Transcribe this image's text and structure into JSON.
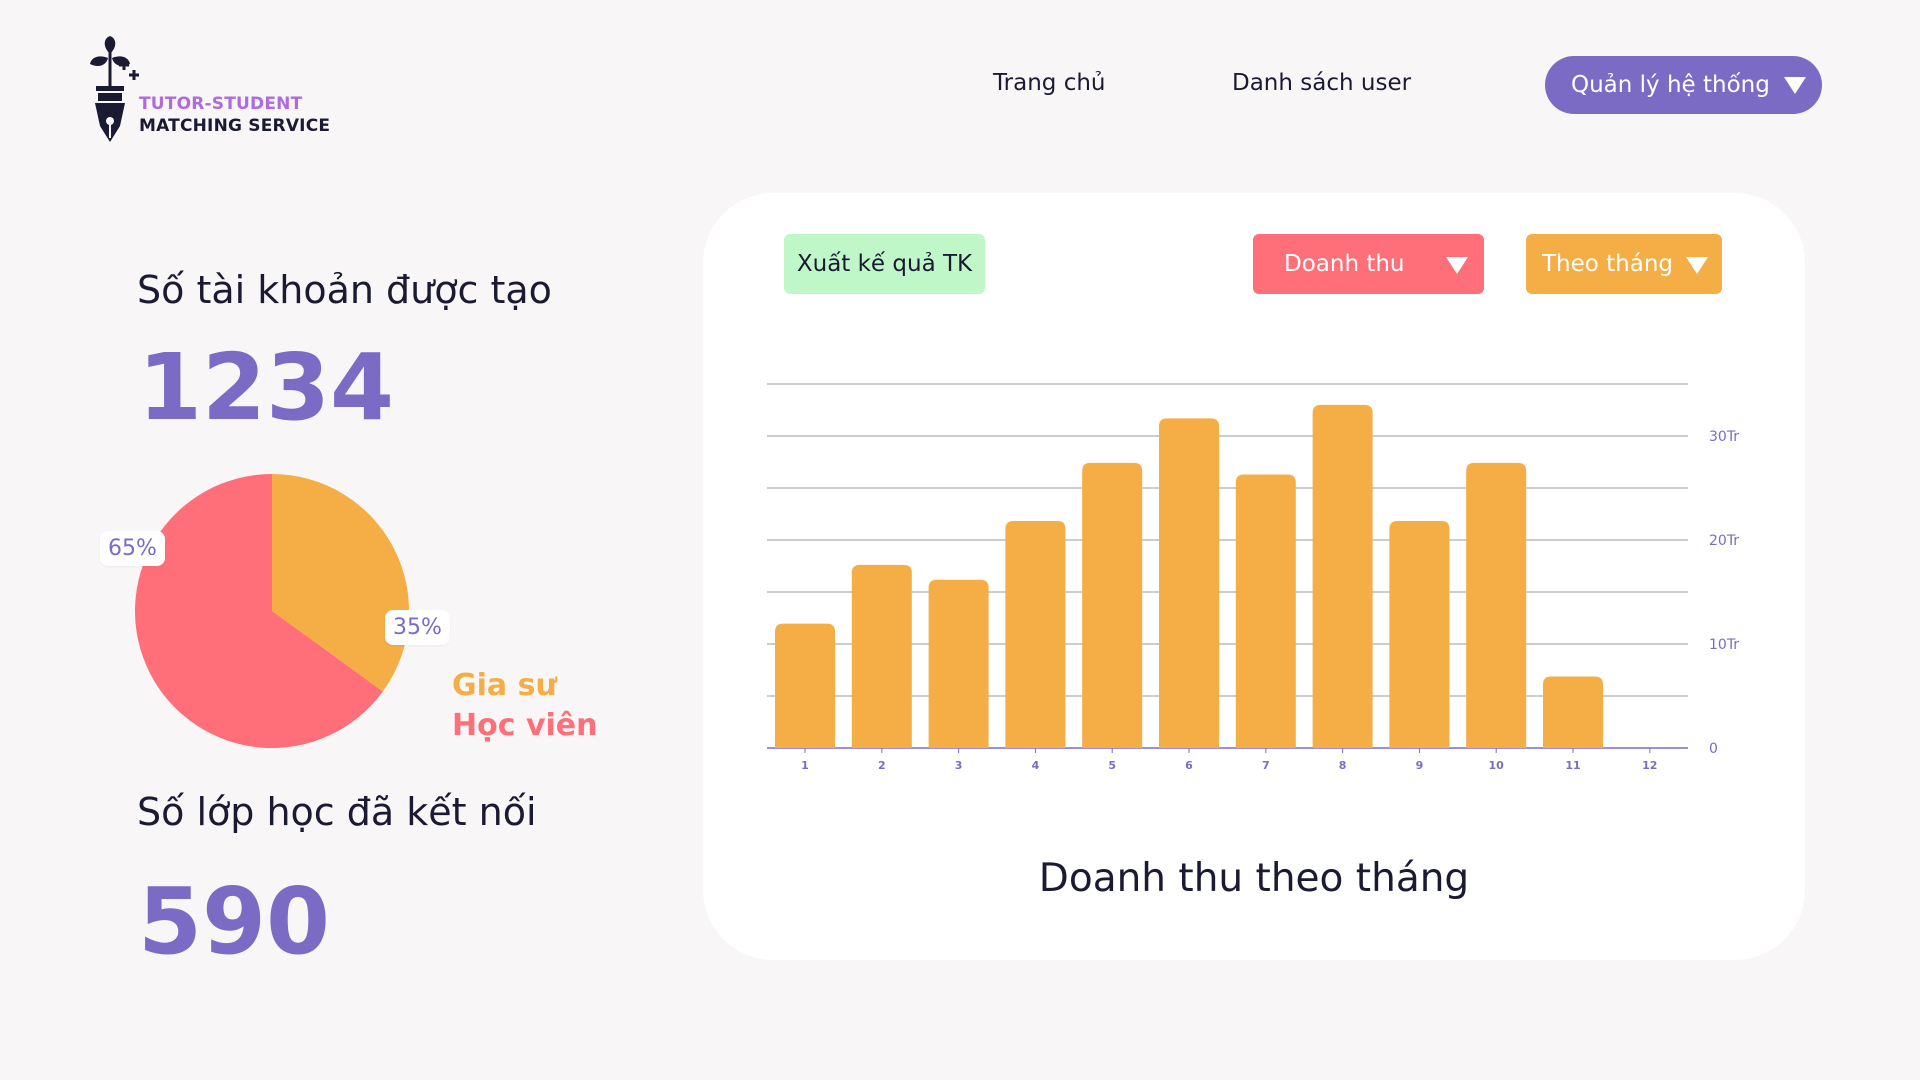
{
  "logo": {
    "line1": "TUTOR-STUDENT",
    "line2": "MATCHING SERVICE"
  },
  "nav": {
    "home": "Trang chủ",
    "users": "Danh sách user",
    "admin": "Quản lý hệ thống"
  },
  "stats": {
    "accounts_title": "Số tài khoản được tạo",
    "accounts_value": "1234",
    "classes_title": "Số lớp học đã kết nối",
    "classes_value": "590"
  },
  "pie": {
    "slices": [
      {
        "label": "Gia sư",
        "value": 35,
        "color": "#f4ae45",
        "pct_text": "35%"
      },
      {
        "label": "Học viên",
        "value": 65,
        "color": "#ff6f79",
        "pct_text": "65%"
      }
    ]
  },
  "controls": {
    "export": "Xuất kế quả TK",
    "metric": "Doanh thu",
    "period": "Theo tháng"
  },
  "colors": {
    "accent": "#7c6bc4",
    "bar": "#f4ae45",
    "revenue_button": "#ff6f79",
    "export_button": "#bff7c9"
  },
  "chart_data": {
    "type": "bar",
    "title": "Doanh thu theo tháng",
    "categories": [
      "1",
      "2",
      "3",
      "4",
      "5",
      "6",
      "7",
      "8",
      "9",
      "10",
      "11",
      "12"
    ],
    "values": [
      11959600,
      17603600,
      16179400,
      21823400,
      27413400,
      31691000,
      26295000,
      32991000,
      21823400,
      27413400,
      6878200,
      0
    ],
    "y_ticks": [
      {
        "value": 0,
        "label": "0"
      },
      {
        "value": 10000000,
        "label": "10Tr"
      },
      {
        "value": 20000000,
        "label": "20Tr"
      },
      {
        "value": 30000000,
        "label": "30Tr"
      }
    ],
    "ylim": [
      0,
      35000000
    ],
    "grid": true,
    "y_axis_side": "right"
  }
}
